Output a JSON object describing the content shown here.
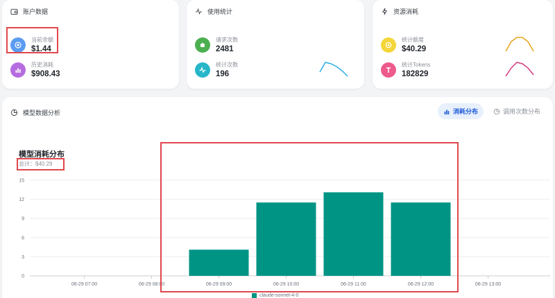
{
  "account": {
    "title": "账户数据",
    "icon": "wallet-icon",
    "balance": {
      "label": "当前余额",
      "value": "$1.44",
      "color": "#5b9cf0",
      "icon": "coin-icon"
    },
    "history": {
      "label": "历史消耗",
      "value": "$908.43",
      "color": "#b56ce0",
      "icon": "bar-chart-icon"
    }
  },
  "usage": {
    "title": "使用统计",
    "icon": "pulse-icon",
    "requests": {
      "label": "请求次数",
      "value": "2481",
      "color": "#4caf50",
      "icon": "send-icon"
    },
    "stats": {
      "label": "统计次数",
      "value": "196",
      "color": "#26b6c8",
      "icon": "pulse-icon"
    },
    "spark_color": "#29aee0"
  },
  "resource": {
    "title": "资源消耗",
    "icon": "bolt-icon",
    "quota": {
      "label": "统计额度",
      "value": "$40.29",
      "color": "#f5d63a",
      "icon": "coin-icon"
    },
    "tokens": {
      "label": "统计Tokens",
      "value": "182829",
      "color": "#ee5a8c",
      "icon": "text-icon"
    },
    "spark_color_1": "#e8a317",
    "spark_color_2": "#d63b7f"
  },
  "model": {
    "title": "模型数据分析",
    "icon": "pie-icon",
    "tabs": [
      {
        "label": "消耗分布",
        "active": true,
        "icon": "bar-chart-icon"
      },
      {
        "label": "调用次数分布",
        "active": false,
        "icon": "pie-icon"
      }
    ]
  },
  "chart_data": {
    "type": "bar",
    "title": "模型消耗分布",
    "subtitle": "总计：$40.29",
    "categories": [
      "06-29 07:00",
      "06-29 08:00",
      "06-29 09:00",
      "06-29 10:00",
      "06-29 11:00",
      "06-29 12:00",
      "06-29 13:00"
    ],
    "series": [
      {
        "name": "claude-sonnet-4-0",
        "values": [
          0,
          0,
          4.1,
          11.5,
          13.1,
          11.5,
          0
        ],
        "color": "#009485"
      }
    ],
    "yticks": [
      0,
      3,
      6,
      9,
      12,
      15
    ],
    "ylim": [
      0,
      15
    ],
    "grid": true,
    "legend": "bottom"
  }
}
